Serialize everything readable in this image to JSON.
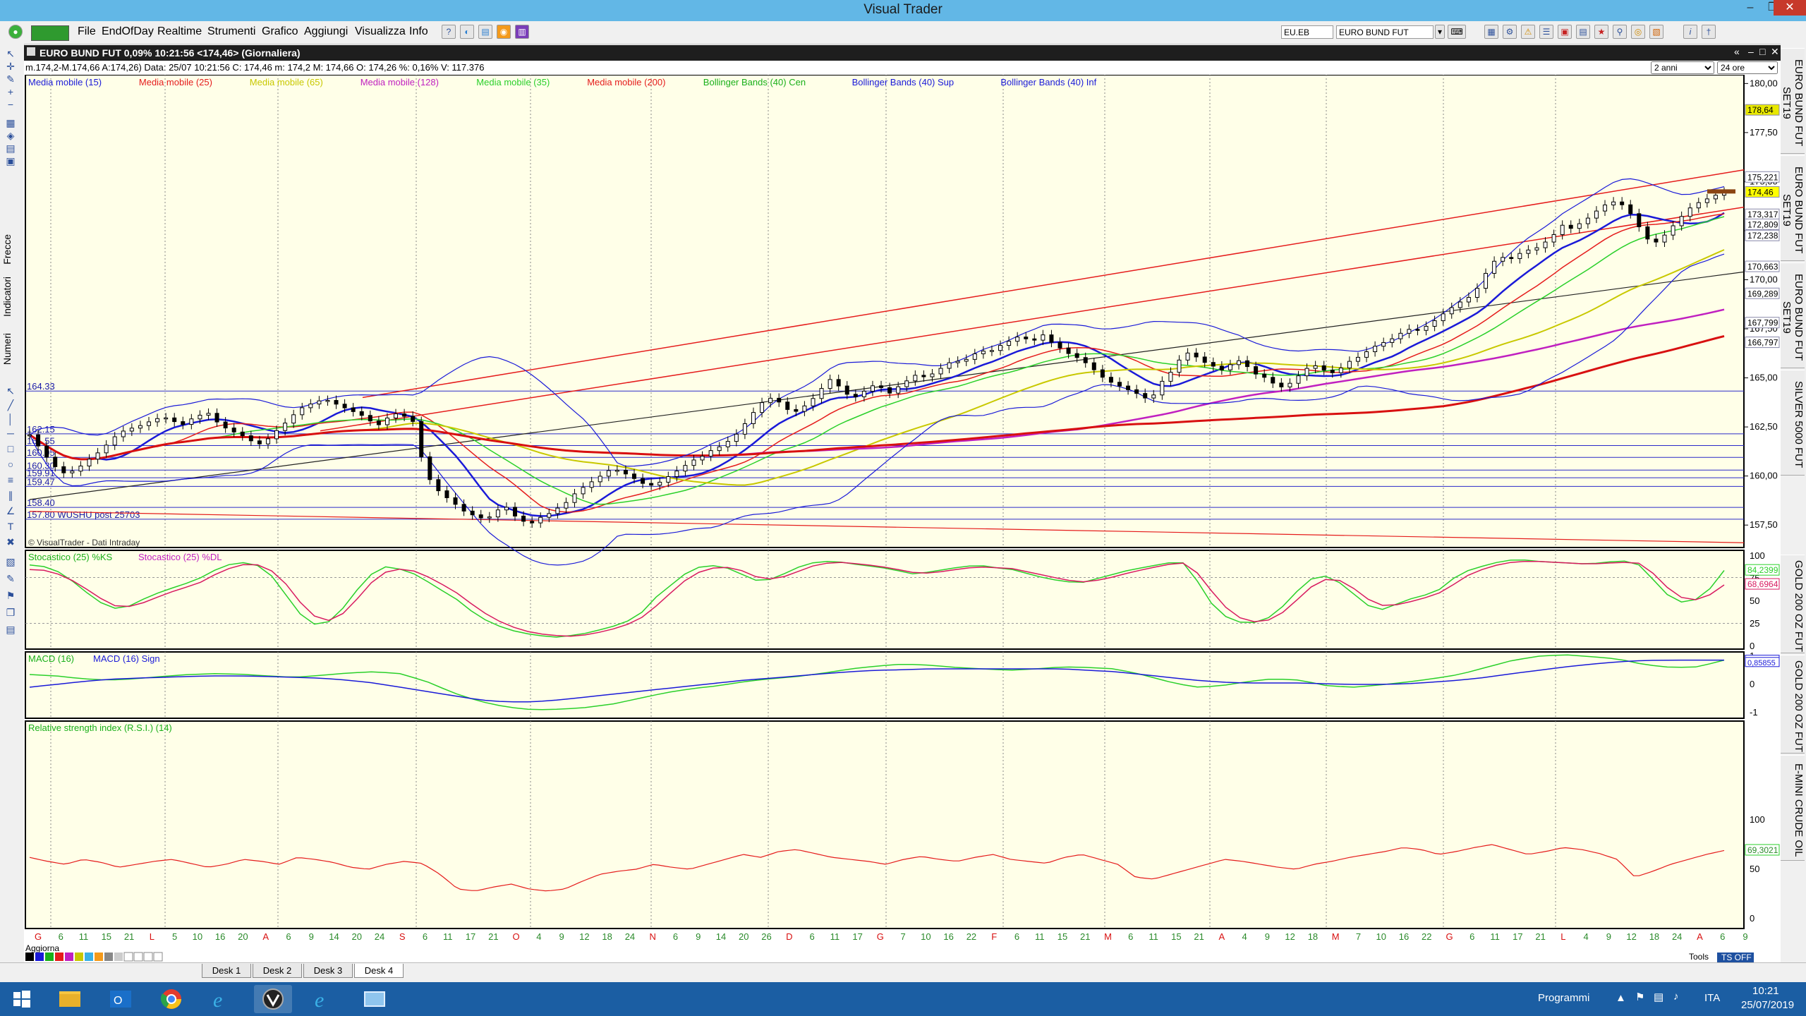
{
  "window": {
    "title": "Visual Trader",
    "menu": [
      "File",
      "EndOfDay",
      "Realtime",
      "Strumenti",
      "Grafico",
      "Aggiungi",
      "Visualizza",
      "Info"
    ],
    "symbol_field": "EU.EB",
    "name_field": "EURO BUND FUT"
  },
  "left_tabs": [
    "Frecce",
    "Indicatori",
    "Numeri"
  ],
  "chart_header": {
    "title": "EURO BUND FUT 0,09% 10:21:56 <174,46> (Giornaliera)",
    "info": "m.174,2-M.174,66 A:174,26) Data: 25/07 10:21:56  C: 174,46   m: 174,2   M: 174,66   O: 174,26   %: 0,16%   V: 117.376",
    "period_select": "2 anni",
    "interval_select": "24 ore",
    "watermark": "© VisualTrader - Dati Intraday"
  },
  "legend": [
    {
      "label": "Media mobile (15)",
      "color": "#1a1ad8"
    },
    {
      "label": "Media mobile (25)",
      "color": "#e51c1c"
    },
    {
      "label": "Media mobile (65)",
      "color": "#c8c800"
    },
    {
      "label": "Media mobile (128)",
      "color": "#c020c0"
    },
    {
      "label": "Media mobile (35)",
      "color": "#2ad02a"
    },
    {
      "label": "Media mobile (200)",
      "color": "#e51c1c"
    },
    {
      "label": "Bollinger Bands (40) Cen",
      "color": "#1ab01a"
    },
    {
      "label": "Bollinger Bands (40) Sup",
      "color": "#1a1ad8"
    },
    {
      "label": "Bollinger Bands (40) Inf",
      "color": "#1a1ad8"
    }
  ],
  "price_axis": {
    "ticks": [
      "180,00",
      "177,50",
      "175,00",
      "172,50",
      "170,00",
      "167,50",
      "165,00",
      "162,50",
      "160,00",
      "157,50"
    ],
    "range": [
      156.5,
      180.3
    ],
    "value_tags": [
      {
        "label": "178,64",
        "color": "#e8e800",
        "value": 178.64
      },
      {
        "label": "175,221",
        "color": "#ffffff",
        "value": 175.221
      },
      {
        "label": "174,46",
        "color": "#ffff00",
        "value": 174.46
      },
      {
        "label": "173,317",
        "color": "#ffffff",
        "value": 173.317
      },
      {
        "label": "172,809",
        "color": "#ffffff",
        "value": 172.809
      },
      {
        "label": "172,238",
        "color": "#ffffff",
        "value": 172.238
      },
      {
        "label": "170,663",
        "color": "#ffffff",
        "value": 170.663
      },
      {
        "label": "169,289",
        "color": "#ffffff",
        "value": 169.289
      },
      {
        "label": "167,799",
        "color": "#ffffff",
        "value": 167.799
      },
      {
        "label": "166,797",
        "color": "#ffffff",
        "value": 166.797
      }
    ]
  },
  "horizontal_levels": [
    {
      "label": "164.33",
      "value": 164.33
    },
    {
      "label": "162.15",
      "value": 162.15
    },
    {
      "label": "161.55",
      "value": 161.55
    },
    {
      "label": "160.95",
      "value": 160.95
    },
    {
      "label": "160.30",
      "value": 160.3
    },
    {
      "label": "159.91",
      "value": 159.91
    },
    {
      "label": "159.47",
      "value": 159.47
    },
    {
      "label": "158.40",
      "value": 158.4
    },
    {
      "label": "157.80 WUSHU post 25703",
      "value": 157.8
    }
  ],
  "stochastic": {
    "title_k": "Stocastico (25) %KS",
    "title_d": "Stocastico (25) %DL",
    "ticks": [
      "100",
      "75",
      "50",
      "25",
      "0"
    ],
    "value_k": "84,2399",
    "value_d": "68,6964"
  },
  "macd": {
    "title": "MACD (16)",
    "title_sign": "MACD (16) Sign",
    "ticks": [
      "1",
      "0",
      "-1"
    ],
    "value_a": "0,86185",
    "value_b": "0,85855"
  },
  "rsi": {
    "title": "Relative strength index (R.S.I.) (14)",
    "ticks": [
      "100",
      "50",
      "0"
    ],
    "value": "69,3021"
  },
  "date_axis": {
    "labels": [
      "G",
      "6",
      "11",
      "15",
      "21",
      "L",
      "5",
      "10",
      "16",
      "20",
      "A",
      "6",
      "9",
      "14",
      "20",
      "24",
      "S",
      "6",
      "11",
      "17",
      "21",
      "O",
      "4",
      "9",
      "12",
      "18",
      "24",
      "N",
      "6",
      "9",
      "14",
      "20",
      "26",
      "D",
      "6",
      "11",
      "17",
      "G",
      "7",
      "10",
      "16",
      "22",
      "F",
      "6",
      "11",
      "15",
      "21",
      "M",
      "6",
      "11",
      "15",
      "21",
      "A",
      "4",
      "9",
      "12",
      "18",
      "M",
      "7",
      "10",
      "16",
      "22",
      "G",
      "6",
      "11",
      "17",
      "21",
      "L",
      "4",
      "9",
      "12",
      "18",
      "24",
      "A",
      "6",
      "9"
    ],
    "footer_left": "Aggiorna",
    "footer_tools": "Tools",
    "footer_ts": "TS OFF"
  },
  "right_tabs": [
    "EURO BUND FUT SET19",
    "EURO BUND FUT SET19",
    "EURO BUND FUT SET19",
    "SILVER 5000 FUT",
    "GOLD 200 OZ FUT",
    "GOLD 200 OZ FUT",
    "E-MINI CRUDE OIL"
  ],
  "desks": [
    "Desk 1",
    "Desk 2",
    "Desk 3",
    "Desk 4"
  ],
  "taskbar": {
    "programmi": "Programmi",
    "lang": "ITA",
    "time": "10:21",
    "date": "25/07/2019"
  },
  "chart_data": {
    "type": "line",
    "ylim": [
      156.5,
      180.3
    ],
    "candles_close": [
      162.1,
      161.5,
      160.9,
      160.4,
      160.1,
      160.3,
      160.6,
      161.0,
      161.3,
      161.8,
      162.2,
      162.4,
      162.5,
      162.7,
      162.9,
      163.0,
      162.8,
      162.6,
      162.9,
      163.1,
      163.2,
      162.7,
      162.4,
      162.2,
      162.0,
      161.7,
      161.6,
      162.1,
      162.5,
      162.9,
      163.4,
      163.6,
      163.8,
      163.9,
      163.7,
      163.5,
      163.3,
      163.1,
      162.8,
      162.6,
      163.0,
      163.2,
      163.0,
      162.7,
      160.2,
      159.6,
      159.0,
      158.8,
      158.3,
      158.1,
      157.9,
      157.8,
      158.2,
      158.5,
      158.0,
      157.7,
      157.6,
      157.9,
      158.1,
      158.4,
      158.7,
      159.2,
      159.5,
      159.8,
      160.1,
      160.4,
      160.2,
      160.0,
      159.7,
      159.5,
      159.6,
      159.9,
      160.2,
      160.5,
      160.8,
      161.0,
      161.3,
      161.5,
      161.8,
      162.2,
      162.8,
      163.4,
      163.9,
      164.0,
      163.6,
      163.2,
      163.4,
      163.8,
      164.2,
      165.0,
      164.7,
      164.2,
      164.0,
      164.3,
      164.6,
      164.5,
      164.2,
      164.6,
      164.9,
      165.2,
      165.0,
      165.3,
      165.6,
      165.9,
      165.8,
      166.1,
      166.4,
      166.3,
      166.6,
      166.8,
      167.1,
      167.0,
      166.9,
      167.2,
      166.8,
      166.5,
      166.2,
      166.0,
      165.7,
      165.3,
      164.9,
      164.7,
      164.5,
      164.3,
      164.1,
      163.8,
      164.7,
      165.1,
      165.8,
      166.3,
      166.1,
      165.8,
      165.6,
      165.4,
      165.7,
      165.9,
      165.5,
      165.1,
      165.0,
      164.6,
      164.5,
      164.9,
      165.3,
      165.7,
      165.5,
      165.2,
      165.4,
      165.8,
      166.0,
      166.3,
      166.6,
      166.8,
      167.0,
      167.3,
      167.5,
      167.4,
      167.7,
      168.0,
      168.4,
      168.7,
      169.0,
      169.2,
      170.0,
      170.8,
      171.2,
      171.0,
      171.3,
      171.5,
      171.6,
      171.9,
      172.3,
      172.8,
      172.6,
      172.9,
      173.2,
      173.6,
      173.9,
      174.0,
      173.7,
      173.1,
      172.3,
      171.8,
      172.1,
      172.6,
      173.1,
      173.6,
      173.9,
      174.1,
      174.3,
      174.46
    ],
    "stoch_k": [
      90,
      88,
      80,
      65,
      50,
      42,
      45,
      55,
      62,
      68,
      75,
      85,
      92,
      93,
      85,
      60,
      35,
      22,
      30,
      55,
      78,
      88,
      85,
      78,
      65,
      55,
      40,
      28,
      20,
      15,
      12,
      10,
      12,
      15,
      20,
      25,
      35,
      55,
      70,
      85,
      90,
      88,
      80,
      72,
      75,
      85,
      92,
      94,
      93,
      90,
      88,
      85,
      80,
      82,
      85,
      88,
      90,
      87,
      85,
      80,
      75,
      72,
      70,
      75,
      80,
      85,
      88,
      92,
      94,
      70,
      40,
      28,
      25,
      30,
      45,
      65,
      80,
      75,
      60,
      45,
      40,
      50,
      55,
      60,
      75,
      85,
      90,
      95,
      96,
      94,
      93,
      92,
      91,
      93,
      95,
      90,
      70,
      50,
      48,
      60,
      84
    ],
    "stoch_d": [
      85,
      84,
      78,
      68,
      55,
      45,
      44,
      50,
      58,
      64,
      70,
      80,
      88,
      92,
      88,
      72,
      48,
      30,
      28,
      45,
      68,
      82,
      86,
      82,
      72,
      62,
      48,
      35,
      25,
      18,
      14,
      12,
      11,
      13,
      17,
      22,
      30,
      45,
      62,
      78,
      86,
      88,
      84,
      76,
      74,
      80,
      88,
      92,
      93,
      91,
      89,
      86,
      82,
      81,
      83,
      86,
      88,
      87,
      86,
      82,
      78,
      74,
      71,
      73,
      77,
      82,
      86,
      90,
      93,
      80,
      55,
      35,
      27,
      28,
      38,
      55,
      72,
      76,
      66,
      52,
      44,
      47,
      52,
      57,
      68,
      80,
      87,
      92,
      94,
      94,
      93,
      92,
      91,
      92,
      93,
      92,
      78,
      58,
      50,
      55,
      68
    ],
    "macd": [
      0.35,
      0.3,
      0.2,
      0.15,
      0.2,
      0.28,
      0.35,
      0.38,
      0.36,
      0.3,
      0.25,
      0.32,
      0.4,
      0.45,
      0.38,
      0.1,
      -0.3,
      -0.6,
      -0.8,
      -0.9,
      -0.88,
      -0.82,
      -0.7,
      -0.5,
      -0.3,
      -0.15,
      -0.05,
      0.1,
      0.2,
      0.28,
      0.4,
      0.55,
      0.65,
      0.72,
      0.68,
      0.6,
      0.55,
      0.5,
      0.55,
      0.62,
      0.6,
      0.55,
      0.35,
      0.1,
      -0.1,
      -0.05,
      0.1,
      0.2,
      0.15,
      -0.05,
      -0.1,
      -0.02,
      0.08,
      0.2,
      0.35,
      0.6,
      0.85,
      1.0,
      1.05,
      0.98,
      0.9,
      0.7,
      0.6,
      0.62,
      0.86
    ],
    "macd_sign": [
      -0.1,
      0.0,
      0.1,
      0.18,
      0.22,
      0.25,
      0.28,
      0.3,
      0.3,
      0.28,
      0.25,
      0.22,
      0.15,
      0.05,
      -0.1,
      -0.25,
      -0.4,
      -0.55,
      -0.62,
      -0.62,
      -0.55,
      -0.45,
      -0.35,
      -0.25,
      -0.15,
      -0.05,
      0.05,
      0.15,
      0.22,
      0.3,
      0.38,
      0.45,
      0.5,
      0.52,
      0.55,
      0.55,
      0.55,
      0.55,
      0.55,
      0.55,
      0.5,
      0.45,
      0.35,
      0.25,
      0.15,
      0.08,
      0.05,
      0.05,
      0.05,
      0.02,
      0.0,
      0.0,
      0.02,
      0.08,
      0.15,
      0.25,
      0.38,
      0.5,
      0.62,
      0.72,
      0.8,
      0.85,
      0.86,
      0.86,
      0.86
    ],
    "rsi": [
      62,
      58,
      55,
      60,
      57,
      52,
      55,
      58,
      60,
      56,
      52,
      55,
      60,
      58,
      55,
      62,
      60,
      57,
      52,
      50,
      55,
      58,
      56,
      45,
      30,
      28,
      32,
      35,
      30,
      28,
      30,
      38,
      45,
      48,
      50,
      55,
      52,
      50,
      55,
      60,
      65,
      62,
      68,
      70,
      66,
      62,
      60,
      58,
      55,
      60,
      63,
      60,
      58,
      62,
      65,
      60,
      58,
      56,
      62,
      65,
      60,
      55,
      42,
      40,
      45,
      50,
      55,
      60,
      58,
      55,
      52,
      50,
      55,
      58,
      62,
      65,
      68,
      72,
      70,
      65,
      68,
      72,
      75,
      70,
      65,
      68,
      72,
      70,
      66,
      60,
      42,
      48,
      55,
      60,
      65,
      69
    ]
  }
}
